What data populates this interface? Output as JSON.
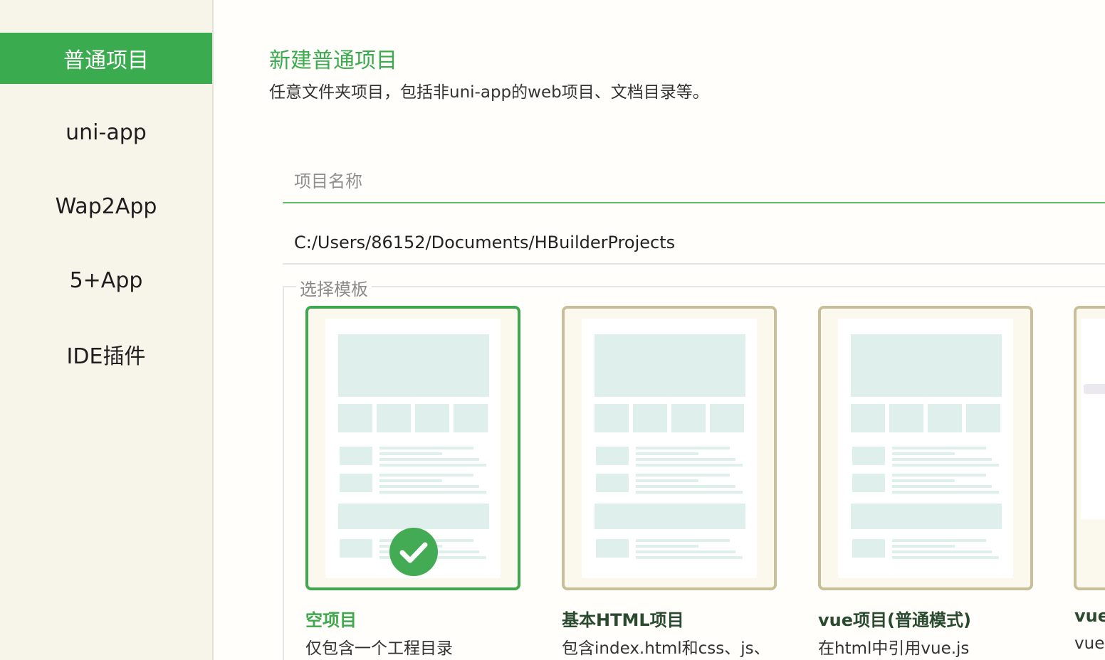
{
  "sidebar": {
    "items": [
      {
        "label": "普通项目",
        "active": true
      },
      {
        "label": "uni-app",
        "active": false
      },
      {
        "label": "Wap2App",
        "active": false
      },
      {
        "label": "5+App",
        "active": false
      },
      {
        "label": "IDE插件",
        "active": false
      }
    ]
  },
  "main": {
    "heading": "新建普通项目",
    "subtitle": "任意文件夹项目，包括非uni-app的web项目、文档目录等。",
    "name_placeholder": "项目名称",
    "path_value": "C:/Users/86152/Documents/HBuilderProjects",
    "template_legend": "选择模板"
  },
  "templates": [
    {
      "title": "空项目",
      "desc": "仅包含一个工程目录",
      "selected": true
    },
    {
      "title": "基本HTML项目",
      "desc": "包含index.html和css、js、",
      "selected": false
    },
    {
      "title": "vue项目(普通模式)",
      "desc": "在html中引用vue.js",
      "selected": false
    },
    {
      "title": "vue",
      "desc": "vue",
      "selected": false
    }
  ],
  "colors": {
    "accent": "#3bab4f",
    "card_border": "#c8bf9a",
    "sidebar_bg": "#f7f4ea"
  },
  "icons": [
    "check-icon"
  ]
}
